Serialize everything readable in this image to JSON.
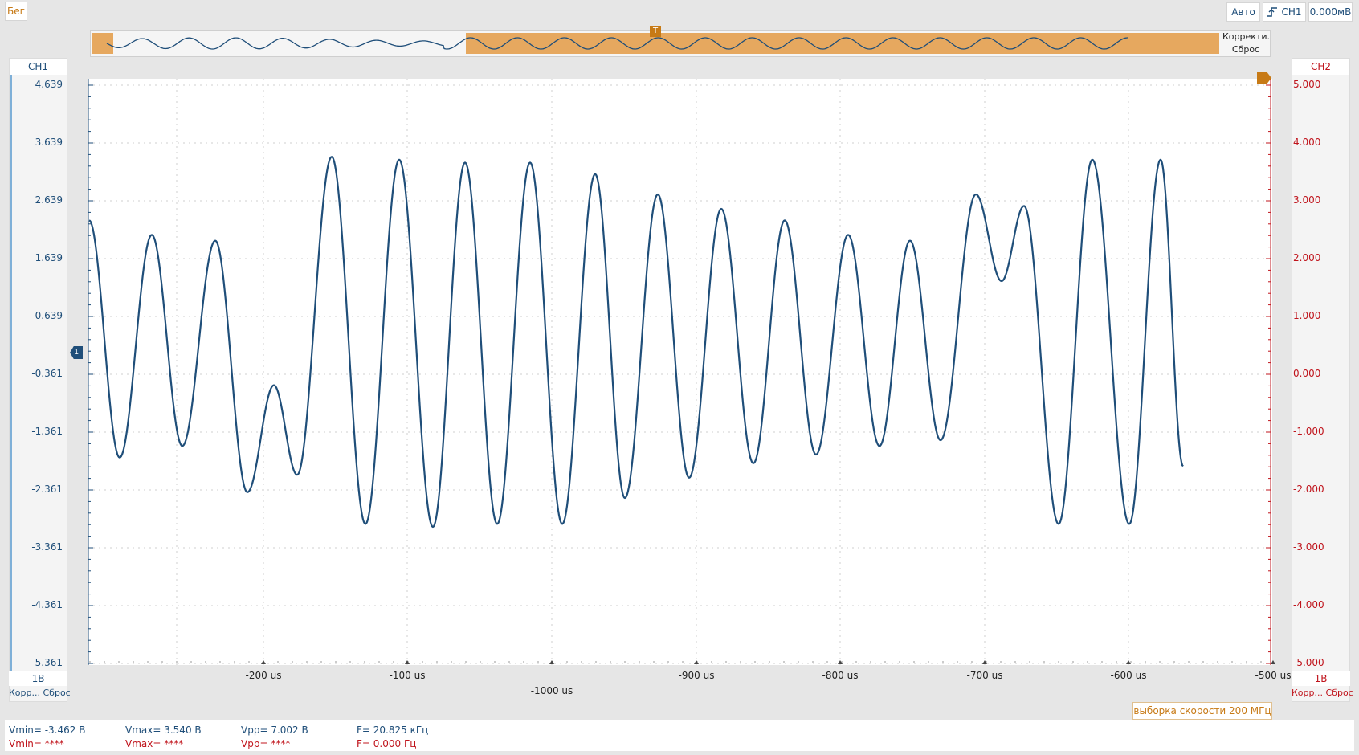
{
  "toolbar": {
    "run_label": "Бег",
    "mode_label": "Авто",
    "trigger_channel": "CH1",
    "trigger_level": "0.000мВ"
  },
  "overview": {
    "adjust_label": "Корректи...",
    "reset_label": "Сброс",
    "trigger_marker": "T"
  },
  "ch1": {
    "title": "CH1",
    "scale": "1В",
    "adjust_label": "Корр...",
    "reset_label": "Сброс",
    "ticks": [
      "4.639",
      "3.639",
      "2.639",
      "1.639",
      "0.639",
      "-0.361",
      "-1.361",
      "-2.361",
      "-3.361",
      "-4.361",
      "-5.361"
    ],
    "color": "#1f4e79"
  },
  "ch2": {
    "title": "CH2",
    "scale": "1В",
    "adjust_label": "Корр...",
    "reset_label": "Сброс",
    "ticks": [
      "5.000",
      "4.000",
      "3.000",
      "2.000",
      "1.000",
      "0.000",
      "-1.000",
      "-2.000",
      "-3.000",
      "-4.000",
      "-5.000"
    ],
    "color": "#c0141c"
  },
  "x_axis": {
    "labels": [
      "-200 us",
      "-100 us",
      "-1000 us",
      "-900 us",
      "-800 us",
      "-700 us",
      "-600 us",
      "-500 us"
    ]
  },
  "sample_rate": "выборка скорости 200 МГц",
  "measurements": {
    "ch1": {
      "vmin": "Vmin= -3.462 В",
      "vmax": "Vmax= 3.540 В",
      "vpp": "Vpp= 7.002 В",
      "freq": "F= 20.825 кГц"
    },
    "ch2": {
      "vmin": "Vmin= ****",
      "vmax": "Vmax= ****",
      "vpp": "Vpp= ****",
      "freq": "F= 0.000 Гц"
    }
  },
  "colors": {
    "accent_orange": "#e6a85f",
    "ch1": "#1f4e79",
    "ch2": "#c0141c",
    "grid": "#c8c8c8"
  },
  "icons": {
    "trigger": "trigger-edge-icon",
    "ch1_marker": "channel-level-marker-icon",
    "trigger_pos": "trigger-position-icon"
  },
  "chart_data": {
    "type": "line",
    "series": [
      {
        "name": "CH1",
        "peaks": [
          {
            "x": 0,
            "y": 2.3
          },
          {
            "x": 38,
            "y": -1.8
          },
          {
            "x": 78,
            "y": 2.05
          },
          {
            "x": 116,
            "y": -1.6
          },
          {
            "x": 157,
            "y": 1.95
          },
          {
            "x": 197,
            "y": -2.4
          },
          {
            "x": 230,
            "y": -0.55
          },
          {
            "x": 259,
            "y": -2.1
          },
          {
            "x": 302,
            "y": 3.4
          },
          {
            "x": 344,
            "y": -2.95
          },
          {
            "x": 386,
            "y": 3.35
          },
          {
            "x": 428,
            "y": -3.0
          },
          {
            "x": 468,
            "y": 3.3
          },
          {
            "x": 508,
            "y": -2.95
          },
          {
            "x": 549,
            "y": 3.3
          },
          {
            "x": 589,
            "y": -2.95
          },
          {
            "x": 630,
            "y": 3.1
          },
          {
            "x": 667,
            "y": -2.5
          },
          {
            "x": 708,
            "y": 2.75
          },
          {
            "x": 747,
            "y": -2.15
          },
          {
            "x": 787,
            "y": 2.5
          },
          {
            "x": 827,
            "y": -1.9
          },
          {
            "x": 866,
            "y": 2.3
          },
          {
            "x": 905,
            "y": -1.75
          },
          {
            "x": 945,
            "y": 2.05
          },
          {
            "x": 984,
            "y": -1.6
          },
          {
            "x": 1022,
            "y": 1.95
          },
          {
            "x": 1060,
            "y": -1.5
          },
          {
            "x": 1104,
            "y": 2.75
          },
          {
            "x": 1136,
            "y": 1.25
          },
          {
            "x": 1164,
            "y": 2.55
          },
          {
            "x": 1207,
            "y": -2.95
          },
          {
            "x": 1249,
            "y": 3.35
          },
          {
            "x": 1295,
            "y": -2.95
          },
          {
            "x": 1334,
            "y": 3.35
          },
          {
            "x": 1362,
            "y": -1.95
          }
        ]
      }
    ]
  }
}
